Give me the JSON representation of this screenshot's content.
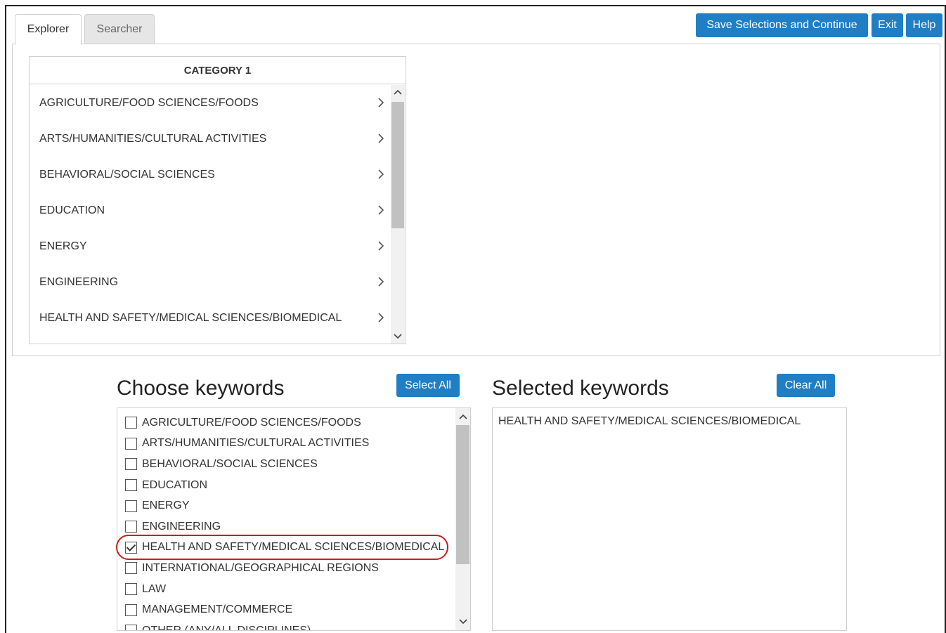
{
  "tabs": [
    {
      "label": "Explorer",
      "active": true
    },
    {
      "label": "Searcher",
      "active": false
    }
  ],
  "toolbar": {
    "save_label": "Save Selections and Continue",
    "exit_label": "Exit",
    "help_label": "Help"
  },
  "category": {
    "header": "CATEGORY 1",
    "items": [
      "AGRICULTURE/FOOD SCIENCES/FOODS",
      "ARTS/HUMANITIES/CULTURAL ACTIVITIES",
      "BEHAVIORAL/SOCIAL SCIENCES",
      "EDUCATION",
      "ENERGY",
      "ENGINEERING",
      "HEALTH AND SAFETY/MEDICAL SCIENCES/BIOMEDICAL"
    ]
  },
  "choose": {
    "title": "Choose keywords",
    "select_all_label": "Select All",
    "items": [
      {
        "label": "AGRICULTURE/FOOD SCIENCES/FOODS",
        "checked": false
      },
      {
        "label": "ARTS/HUMANITIES/CULTURAL ACTIVITIES",
        "checked": false
      },
      {
        "label": "BEHAVIORAL/SOCIAL SCIENCES",
        "checked": false
      },
      {
        "label": "EDUCATION",
        "checked": false
      },
      {
        "label": "ENERGY",
        "checked": false
      },
      {
        "label": "ENGINEERING",
        "checked": false
      },
      {
        "label": "HEALTH AND SAFETY/MEDICAL SCIENCES/BIOMEDICAL",
        "checked": true
      },
      {
        "label": "INTERNATIONAL/GEOGRAPHICAL REGIONS",
        "checked": false
      },
      {
        "label": "LAW",
        "checked": false
      },
      {
        "label": "MANAGEMENT/COMMERCE",
        "checked": false
      },
      {
        "label": "OTHER (ANY/ALL DISCIPLINES)",
        "checked": false
      }
    ]
  },
  "selected": {
    "title": "Selected keywords",
    "clear_all_label": "Clear All",
    "items": [
      "HEALTH AND SAFETY/MEDICAL SCIENCES/BIOMEDICAL"
    ]
  },
  "colors": {
    "button": "#1f7ec4",
    "highlight": "#c81e1e"
  },
  "icons": {
    "item_arrow": "chevron-right-icon",
    "scroll_up": "chevron-up-icon",
    "scroll_down": "chevron-down-icon",
    "checkbox_checked": "check-icon"
  }
}
